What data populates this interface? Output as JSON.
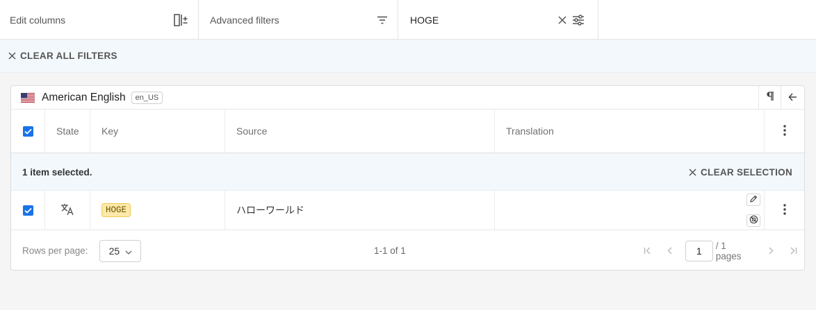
{
  "toolbar": {
    "edit_columns_label": "Edit columns",
    "advanced_filters_label": "Advanced filters",
    "search_value": "HOGE"
  },
  "filters": {
    "clear_all_label": "CLEAR ALL FILTERS"
  },
  "language": {
    "name": "American English",
    "code": "en_US"
  },
  "table": {
    "columns": [
      "State",
      "Key",
      "Source",
      "Translation"
    ],
    "selection_text": "1 item selected.",
    "clear_selection_label": "CLEAR SELECTION",
    "rows": [
      {
        "selected": true,
        "state_icon": "translate-icon",
        "key": "HOGE",
        "source": "ハローワールド",
        "translation": ""
      }
    ]
  },
  "pagination": {
    "rows_per_page_label": "Rows per page:",
    "rows_per_page": "25",
    "range": "1-1 of 1",
    "page": "1",
    "pages_label": "/ 1 pages"
  },
  "colors": {
    "accent": "#1a73e8",
    "key_chip_bg": "#fde9a8",
    "selection_bg": "#f3f8fc"
  }
}
